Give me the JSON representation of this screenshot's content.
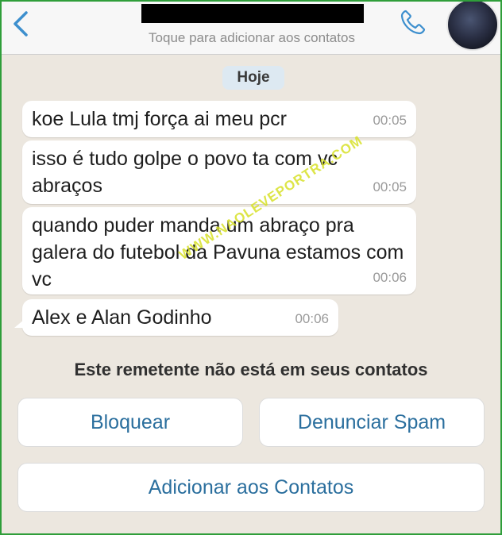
{
  "header": {
    "back_icon": "chevron-left-icon",
    "subtitle": "Toque para adicionar aos contatos",
    "call_icon": "phone-icon",
    "accent_color": "#3d8fce"
  },
  "chat": {
    "date_label": "Hoje",
    "messages": [
      {
        "text": "koe Lula tmj força ai meu pcr",
        "time": "00:05"
      },
      {
        "text": "isso é tudo golpe o povo ta com vc abraços",
        "time": "00:05"
      },
      {
        "text": "quando puder manda um abraço pra galera do futebol da Pavuna estamos com vc",
        "time": "00:06"
      },
      {
        "text": "Alex e Alan Godinho",
        "time": "00:06"
      }
    ],
    "watermark": "WWW.NAOLEVEPORTRA.COM"
  },
  "unknown_sender": {
    "notice": "Este remetente não está em seus contatos",
    "block_label": "Bloquear",
    "report_label": "Denunciar Spam",
    "add_label": "Adicionar aos Contatos"
  }
}
